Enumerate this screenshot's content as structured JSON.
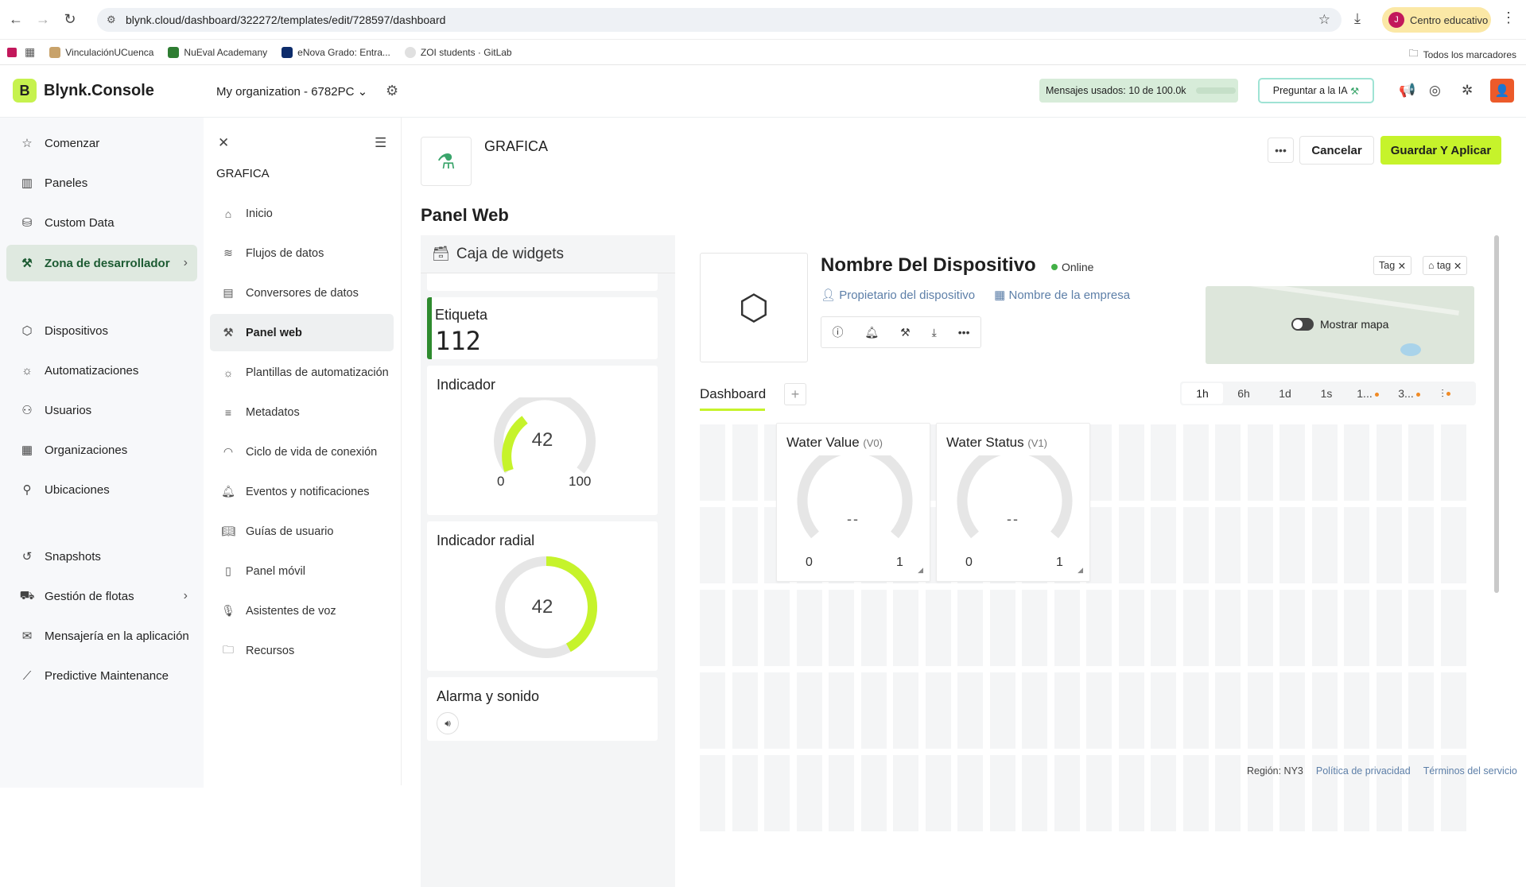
{
  "browser": {
    "url": "blynk.cloud/dashboard/322272/templates/edit/728597/dashboard",
    "profile_initial": "J",
    "profile_label": "Centro educativo",
    "bookmarks": [
      "VinculaciónUCuenca",
      "NuEval Academany",
      "eNova Grado: Entra...",
      "ZOI students · GitLab"
    ],
    "all_bookmarks": "Todos los marcadores"
  },
  "appbar": {
    "logo_letter": "B",
    "logo_text": "Blynk.Console",
    "org": "My organization - 6782PC",
    "messages_label": "Mensajes usados: ",
    "messages_value": "10 de 100.0k",
    "ask_ai": "Preguntar a la IA"
  },
  "leftnav": {
    "items": [
      {
        "label": "Comenzar"
      },
      {
        "label": "Paneles"
      },
      {
        "label": "Custom Data"
      },
      {
        "label": "Zona de desarrollador"
      },
      {
        "label": "Dispositivos"
      },
      {
        "label": "Automatizaciones"
      },
      {
        "label": "Usuarios"
      },
      {
        "label": "Organizaciones"
      },
      {
        "label": "Ubicaciones"
      },
      {
        "label": "Snapshots"
      },
      {
        "label": "Gestión de flotas"
      },
      {
        "label": "Mensajería en la aplicación"
      },
      {
        "label": "Predictive Maintenance"
      }
    ]
  },
  "subnav": {
    "title": "GRAFICA",
    "items": [
      {
        "label": "Inicio"
      },
      {
        "label": "Flujos de datos"
      },
      {
        "label": "Conversores de datos"
      },
      {
        "label": "Panel web"
      },
      {
        "label": "Plantillas de automatización"
      },
      {
        "label": "Metadatos"
      },
      {
        "label": "Ciclo de vida de conexión"
      },
      {
        "label": "Eventos y notificaciones"
      },
      {
        "label": "Guías de usuario"
      },
      {
        "label": "Panel móvil"
      },
      {
        "label": "Asistentes de voz"
      },
      {
        "label": "Recursos"
      }
    ]
  },
  "main": {
    "template_name": "GRAFICA",
    "cancel": "Cancelar",
    "save": "Guardar Y Aplicar",
    "panel_title": "Panel Web"
  },
  "widgetbox": {
    "title": "Caja de widgets",
    "label_card": {
      "title": "Etiqueta",
      "value": "112"
    },
    "gauge_card": {
      "title": "Indicador",
      "value": "42",
      "min": "0",
      "max": "100"
    },
    "radial_card": {
      "title": "Indicador radial",
      "value": "42"
    },
    "alarm_card": {
      "title": "Alarma y sonido"
    }
  },
  "device": {
    "name": "Nombre Del Dispositivo",
    "status": "Online",
    "owner": "Propietario del dispositivo",
    "company": "Nombre de la empresa",
    "tag1": "Tag",
    "tag2": "tag",
    "map_toggle": "Mostrar mapa"
  },
  "dashboard": {
    "tab": "Dashboard",
    "time_ranges": [
      "1h",
      "6h",
      "1d",
      "1s",
      "1...",
      "3..."
    ],
    "widgets": [
      {
        "title": "Water Value",
        "pin": "(V0)",
        "value": "--",
        "min": "0",
        "max": "1"
      },
      {
        "title": "Water Status",
        "pin": "(V1)",
        "value": "--",
        "min": "0",
        "max": "1"
      }
    ]
  },
  "footer": {
    "region": "Región: NY3",
    "privacy": "Política de privacidad",
    "terms": "Términos del servicio"
  },
  "colors": {
    "accent": "#c6f32b",
    "online": "#43b047",
    "gauge": "#c6f32b"
  }
}
